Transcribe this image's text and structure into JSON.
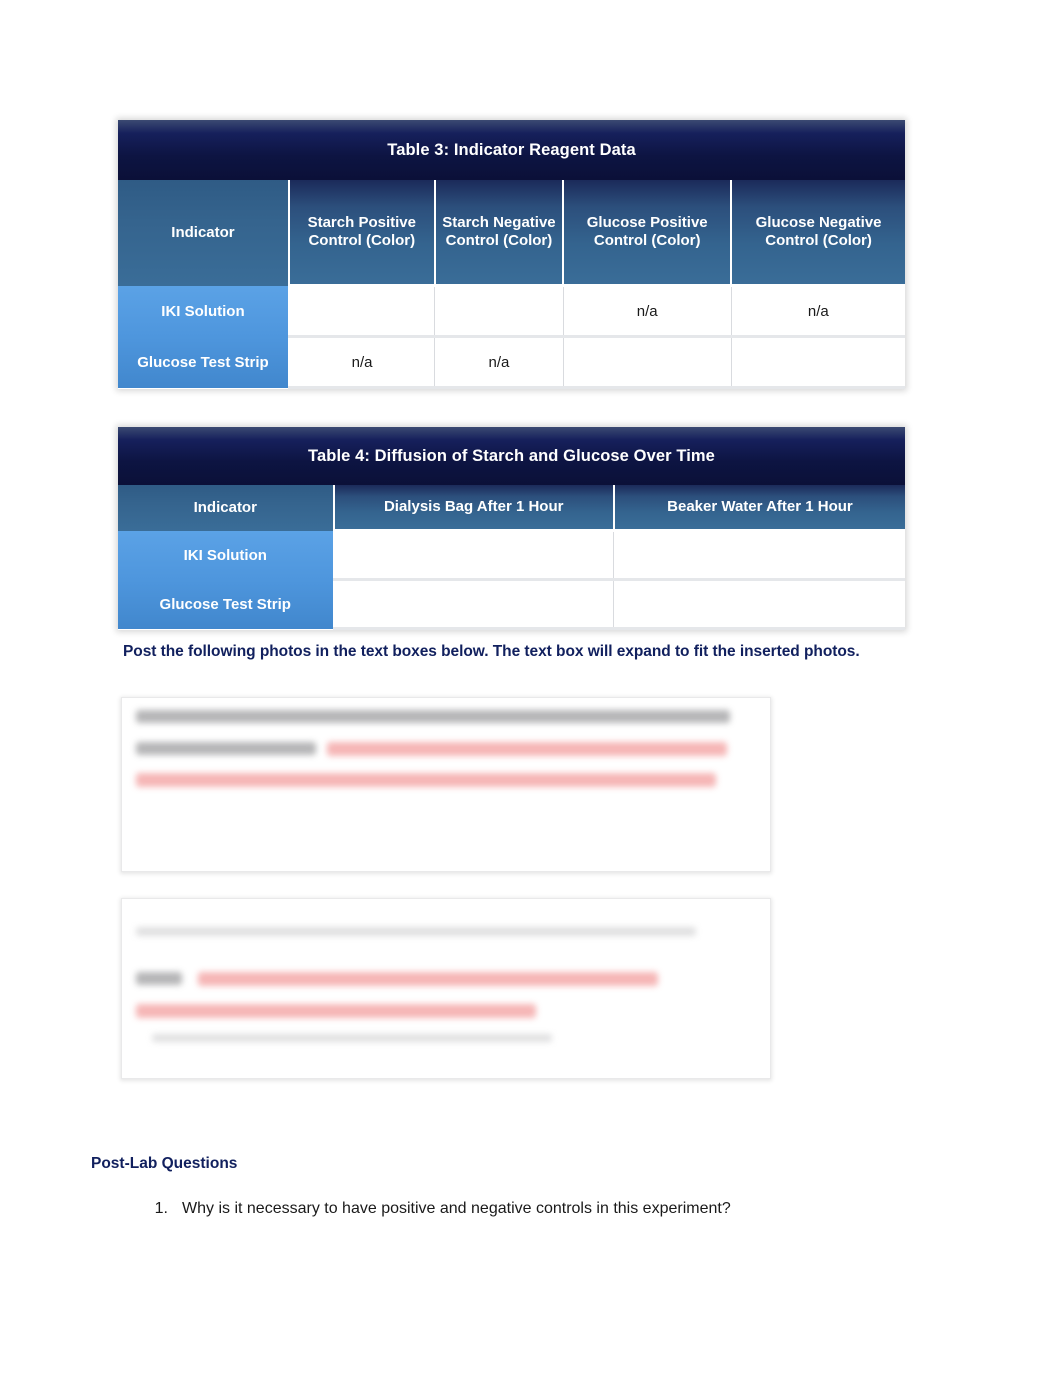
{
  "table3": {
    "title": "Table 3: Indicator Reagent Data",
    "headers": [
      "Indicator",
      "Starch Positive Control (Color)",
      "Starch Negative Control (Color)",
      "Glucose Positive Control (Color)",
      "Glucose Negative Control (Color)"
    ],
    "rows": [
      {
        "label": "IKI Solution",
        "cells": [
          "",
          "",
          "n/a",
          "n/a"
        ]
      },
      {
        "label": "Glucose Test Strip",
        "cells": [
          "n/a",
          "n/a",
          "",
          ""
        ]
      }
    ]
  },
  "table4": {
    "title": "Table 4: Diffusion of Starch and Glucose Over Time",
    "headers": [
      "Indicator",
      "Dialysis Bag After 1 Hour",
      "Beaker Water After 1 Hour"
    ],
    "rows": [
      {
        "label": "IKI Solution",
        "cells": [
          "",
          ""
        ]
      },
      {
        "label": "Glucose Test Strip",
        "cells": [
          "",
          ""
        ]
      }
    ]
  },
  "instruction": "Post the following photos in the text boxes below.  The text box will expand to fit the inserted photos.",
  "photo_boxes": [
    {
      "name": "photo-text-box-1",
      "content": ""
    },
    {
      "name": "photo-text-box-2",
      "content": ""
    }
  ],
  "postlab": {
    "heading": "Post-Lab Questions",
    "questions": [
      {
        "number": "1.",
        "text": "Why is it necessary to have positive and negative controls in this experiment?"
      }
    ]
  },
  "colors": {
    "title_bar": "#0d1442",
    "header_row": "#3a6d98",
    "row_label": "#4a8fd4",
    "heading_text": "#11205e",
    "cell_separator": "#e5e7ea"
  }
}
